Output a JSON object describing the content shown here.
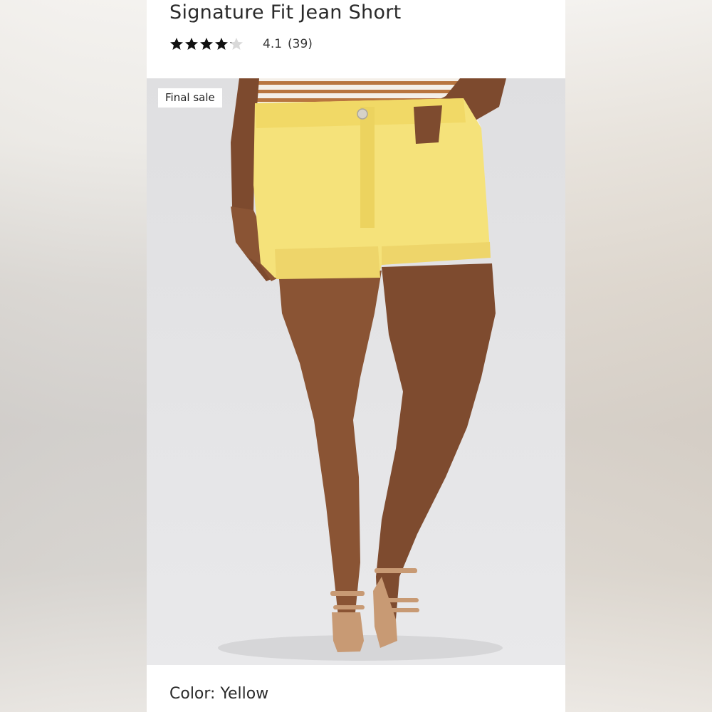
{
  "product": {
    "title": "Signature Fit Jean Short",
    "rating_value": "4.1",
    "rating_count": "(39)",
    "stars_filled": 4,
    "stars_total": 5
  },
  "image": {
    "badge": "Final sale"
  },
  "details": {
    "color_label": "Color: Yellow"
  },
  "colors": {
    "shorts": "#f5e27a",
    "skin": "#8a5434",
    "photo_bg": "#e3e3e5",
    "sandals": "#c89a74"
  },
  "icons": {
    "star": "star-icon"
  }
}
